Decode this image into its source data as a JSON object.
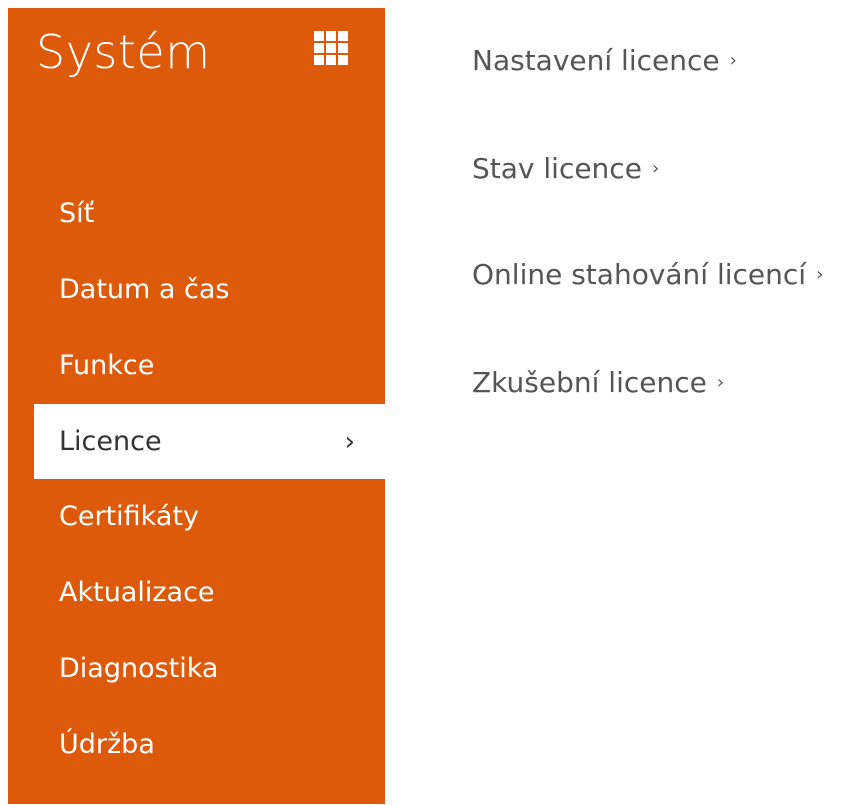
{
  "sidebar": {
    "title": "Systém",
    "items": [
      {
        "label": "Síť"
      },
      {
        "label": "Datum a čas"
      },
      {
        "label": "Funkce"
      },
      {
        "label": "Licence"
      },
      {
        "label": "Certifikáty"
      },
      {
        "label": "Aktualizace"
      },
      {
        "label": "Diagnostika"
      },
      {
        "label": "Údržba"
      }
    ],
    "active_index": 3,
    "accent_color": "#dd5a0a"
  },
  "content": {
    "links": [
      {
        "label": "Nastavení licence"
      },
      {
        "label": "Stav licence"
      },
      {
        "label": "Online stahování licencí"
      },
      {
        "label": "Zkušební licence"
      }
    ]
  },
  "icons": {
    "grid": "grid-icon",
    "chevron": "chevron-right-icon"
  }
}
